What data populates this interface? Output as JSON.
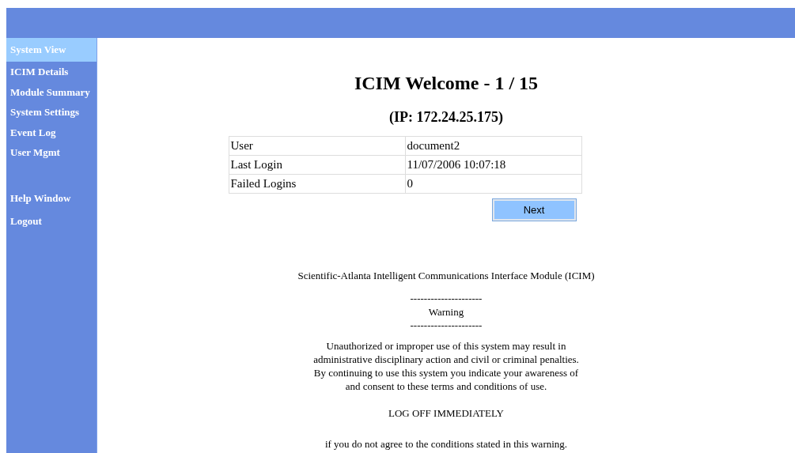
{
  "sidebar": {
    "items": [
      {
        "label": "System View",
        "selected": true
      },
      {
        "label": "ICIM Details",
        "selected": false
      },
      {
        "label": "Module Summary",
        "selected": false
      },
      {
        "label": "System Settings",
        "selected": false
      },
      {
        "label": "Event Log",
        "selected": false
      },
      {
        "label": "User Mgmt",
        "selected": false
      }
    ],
    "footer_items": [
      {
        "label": "Help Window",
        "selected": false
      },
      {
        "label": "Logout",
        "selected": false
      }
    ]
  },
  "title": "ICIM Welcome - 1 / 15",
  "subtitle": "(IP: 172.24.25.175)",
  "table": {
    "rows": [
      [
        "User",
        "document2"
      ],
      [
        "Last Login",
        "11/07/2006 10:07:18"
      ],
      [
        "Failed Logins",
        "0"
      ]
    ]
  },
  "next_button": "Next",
  "notice": {
    "heading": "Scientific-Atlanta Intelligent Communications Interface Module (ICIM)",
    "rule_top": "---------------------",
    "warning": "Warning",
    "rule_bottom": "---------------------",
    "body": "Unauthorized or improper use of this system may result in\nadministrative disciplinary action and civil or criminal penalties.\nBy continuing to use this system you indicate your awareness of\nand consent to these terms and conditions of use.",
    "logoff": "LOG OFF IMMEDIATELY",
    "footer": "if you do not agree to the conditions stated in this warning."
  }
}
